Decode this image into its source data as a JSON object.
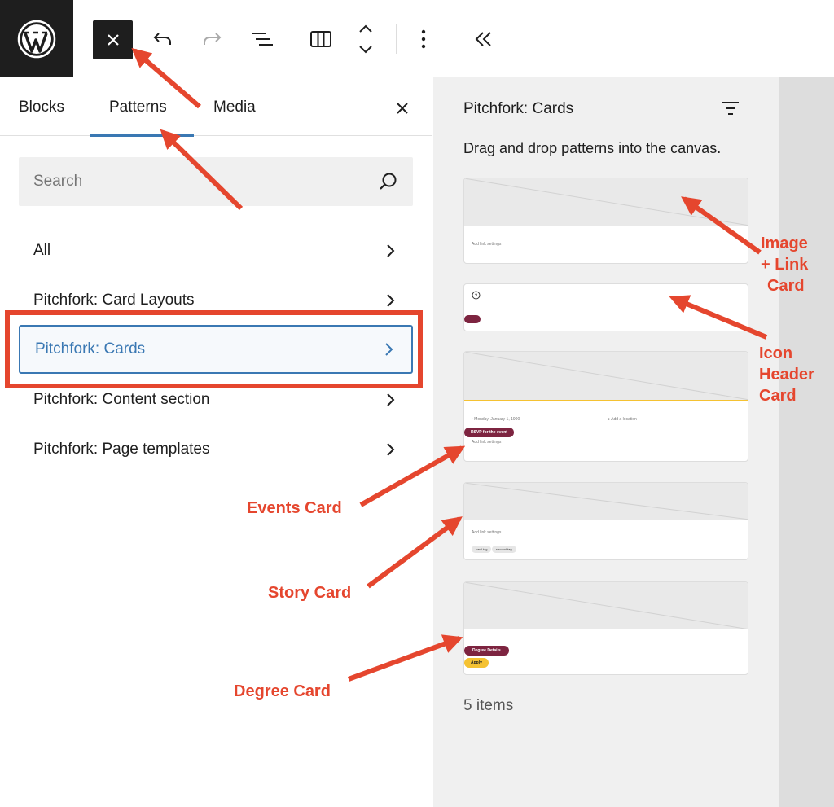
{
  "toolbar": {
    "logo_icon": "wordpress-logo",
    "close_icon": "close-icon",
    "tools": [
      "undo-icon",
      "redo-icon",
      "document-overview-icon",
      "columns-icon",
      "block-mover-icon",
      "more-options-icon",
      "collapse-icon"
    ]
  },
  "tabs": [
    {
      "label": "Blocks"
    },
    {
      "label": "Patterns",
      "active": true
    },
    {
      "label": "Media"
    }
  ],
  "search": {
    "placeholder": "Search"
  },
  "categories": [
    {
      "label": "All"
    },
    {
      "label": "Pitchfork: Card Layouts"
    },
    {
      "label": "Pitchfork: Cards",
      "active": true
    },
    {
      "label": "Pitchfork: Content section"
    },
    {
      "label": "Pitchfork: Page templates"
    }
  ],
  "patterns_panel": {
    "title": "Pitchfork: Cards",
    "description": "Drag and drop patterns into the canvas.",
    "count": "5 items"
  },
  "cards": {
    "image_link": {
      "link": "Add link settings"
    },
    "events": {
      "date": "Monday, January 1, 1900",
      "location": "Add a location",
      "button": "RSVP for the event",
      "link": "Add link settings"
    },
    "story": {
      "link": "Add link settings",
      "tag1": "card tag",
      "tag2": "second tag"
    },
    "degree": {
      "button1": "Degree Details",
      "button2": "Apply"
    }
  },
  "annotations": {
    "image_link": [
      "Image",
      "+ Link",
      "Card"
    ],
    "icon_header": [
      "Icon",
      "Header",
      "Card"
    ],
    "events": "Events Card",
    "story": "Story Card",
    "degree": "Degree Card"
  },
  "colors": {
    "accent": "#3a78b3",
    "annotation": "#e5462e",
    "maroon": "#7d2440",
    "gold": "#f5c232"
  }
}
